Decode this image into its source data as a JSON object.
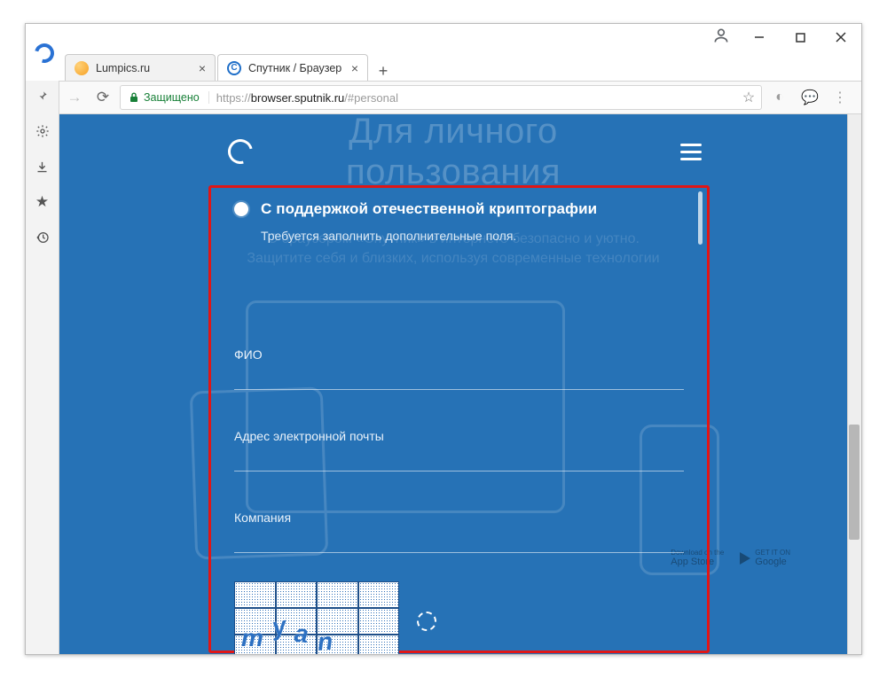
{
  "window": {
    "controls": {
      "min": "—",
      "max": "▢",
      "close": "✕"
    }
  },
  "tabs": [
    {
      "label": "Lumpics.ru",
      "active": false
    },
    {
      "label": "Спутник / Браузер",
      "active": true
    }
  ],
  "toolbar": {
    "secure_label": "Защищено",
    "url_scheme": "https://",
    "url_host": "browser.sputnik.ru",
    "url_path": "/#personal"
  },
  "side_rail": {
    "pin": "📌",
    "settings": "⚙",
    "downloads": "⬇",
    "bookmarks": "★",
    "history": "↻"
  },
  "page": {
    "bg_title_line1": "Для личного",
    "bg_title_line2": "пользования",
    "bg_sub_line1": "С браузером «Спутник» в интернете безопасно и уютно.",
    "bg_sub_line2": "Защитите себя и близких, используя современные технологии",
    "appstore_top": "Download on the",
    "appstore": "App Store",
    "google_top": "GET IT ON",
    "google": "Google"
  },
  "form": {
    "option_title": "С поддержкой отечественной криптографии",
    "option_desc": "Требуется заполнить дополнительные поля.",
    "fio_label": "ФИО",
    "fio_value": "",
    "email_label": "Адрес электронной почты",
    "email_value": "",
    "company_label": "Компания",
    "company_value": "",
    "captcha_chars": [
      "m",
      "y",
      "a",
      "n"
    ]
  }
}
